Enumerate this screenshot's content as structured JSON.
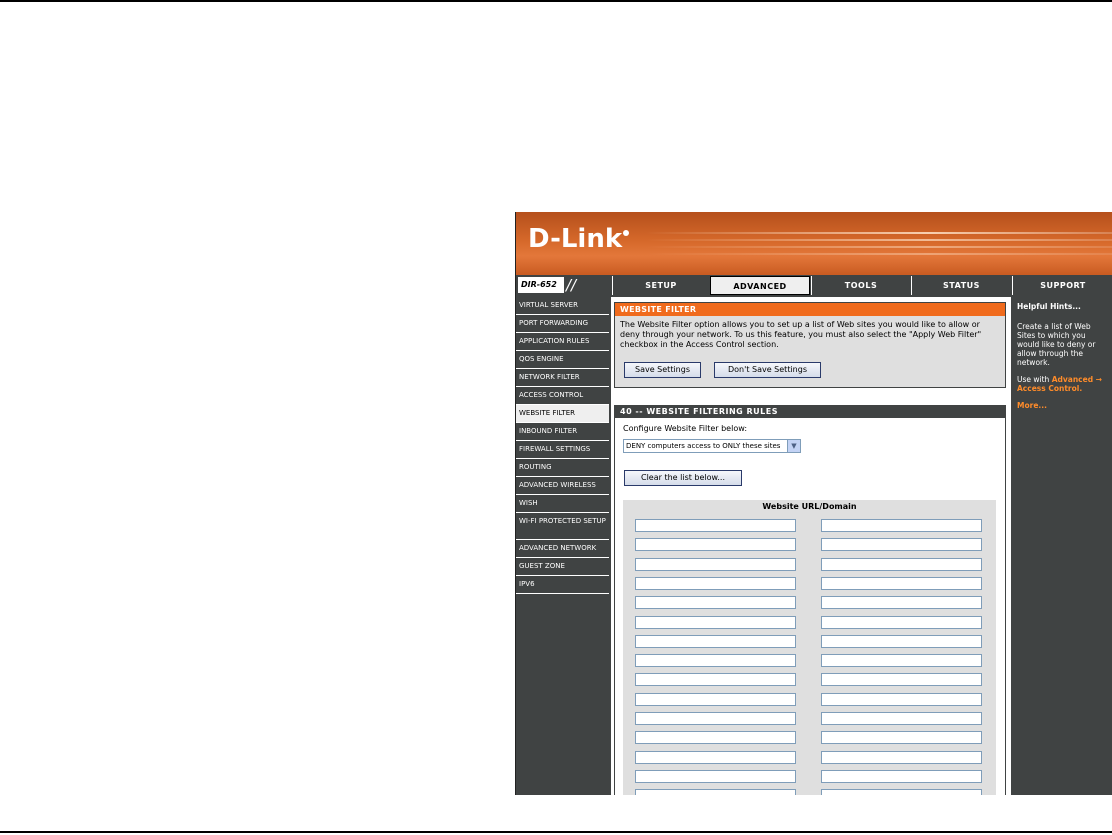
{
  "banner": {
    "logo": "D-Link"
  },
  "header": {
    "model": "DIR-652",
    "slashes": "//"
  },
  "tabs": [
    {
      "label": "SETUP",
      "active": false
    },
    {
      "label": "ADVANCED",
      "active": true
    },
    {
      "label": "TOOLS",
      "active": false
    },
    {
      "label": "STATUS",
      "active": false
    },
    {
      "label": "SUPPORT",
      "active": false
    }
  ],
  "sidebar": {
    "items": [
      {
        "label": "VIRTUAL SERVER"
      },
      {
        "label": "PORT FORWARDING"
      },
      {
        "label": "APPLICATION RULES"
      },
      {
        "label": "QOS ENGINE"
      },
      {
        "label": "NETWORK FILTER"
      },
      {
        "label": "ACCESS CONTROL"
      },
      {
        "label": "WEBSITE FILTER",
        "active": true
      },
      {
        "label": "INBOUND FILTER"
      },
      {
        "label": "FIREWALL SETTINGS"
      },
      {
        "label": "ROUTING"
      },
      {
        "label": "ADVANCED WIRELESS"
      },
      {
        "label": "WISH"
      },
      {
        "label": "WI-FI PROTECTED SETUP"
      },
      {
        "label": "ADVANCED NETWORK"
      },
      {
        "label": "GUEST ZONE"
      },
      {
        "label": "IPV6"
      }
    ]
  },
  "website_filter": {
    "title": "WEBSITE FILTER",
    "description": "The Website Filter option allows you to set up a list of Web sites you would like to allow or deny through your network. To us this feature, you must also select the \"Apply Web Filter\" checkbox in the Access Control section.",
    "save_label": "Save Settings",
    "dont_save_label": "Don't Save Settings"
  },
  "rules": {
    "title": "40 -- WEBSITE FILTERING RULES",
    "configure_label": "Configure Website Filter below:",
    "select_value": "DENY computers access to ONLY these sites",
    "clear_label": "Clear the list below...",
    "column_header": "Website URL/Domain"
  },
  "hints": {
    "title": "Helpful Hints...",
    "text": "Create a list of Web Sites to which you would like to deny or allow through the network.",
    "use_with": "Use with",
    "link": "Advanced → Access Control.",
    "more": "More..."
  },
  "colors": {
    "orange": "#f06b1d",
    "dark": "#404343",
    "panel": "#dfdfdf",
    "link": "#ff8c2a"
  }
}
